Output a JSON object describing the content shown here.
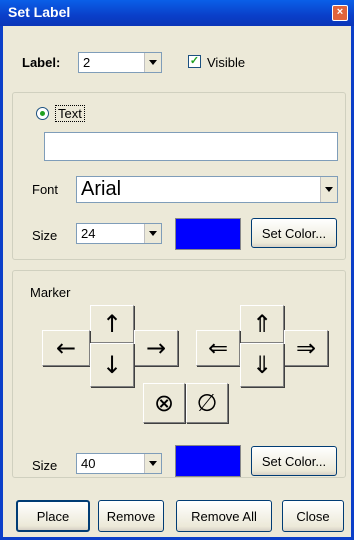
{
  "window": {
    "title": "Set Label",
    "close_glyph": "×"
  },
  "label_row": {
    "label": "Label:",
    "value": "2",
    "visible_label": "Visible",
    "visible_checked": "✓"
  },
  "text_group": {
    "radio_label": "Text",
    "text_value": "",
    "font_label": "Font",
    "font_value": "Arial",
    "size_label": "Size",
    "size_value": "24",
    "color": "#0000ff",
    "set_color_label": "Set Color..."
  },
  "marker_group": {
    "title": "Marker",
    "arrows_single": {
      "up": "↑",
      "down": "↓",
      "left": "←",
      "right": "→"
    },
    "arrows_double": {
      "up": "⇑",
      "down": "⇓",
      "left": "⇐",
      "right": "⇒"
    },
    "circled_x": "⊗",
    "empty_set": "∅",
    "size_label": "Size",
    "size_value": "40",
    "color": "#0000ff",
    "set_color_label": "Set Color..."
  },
  "footer": {
    "place_label": "Place",
    "remove_label": "Remove",
    "remove_all_label": "Remove All",
    "close_label": "Close"
  },
  "icons": [
    "close-icon",
    "dropdown-arrow-icon",
    "checkbox-check-icon",
    "radio-dot-icon"
  ]
}
